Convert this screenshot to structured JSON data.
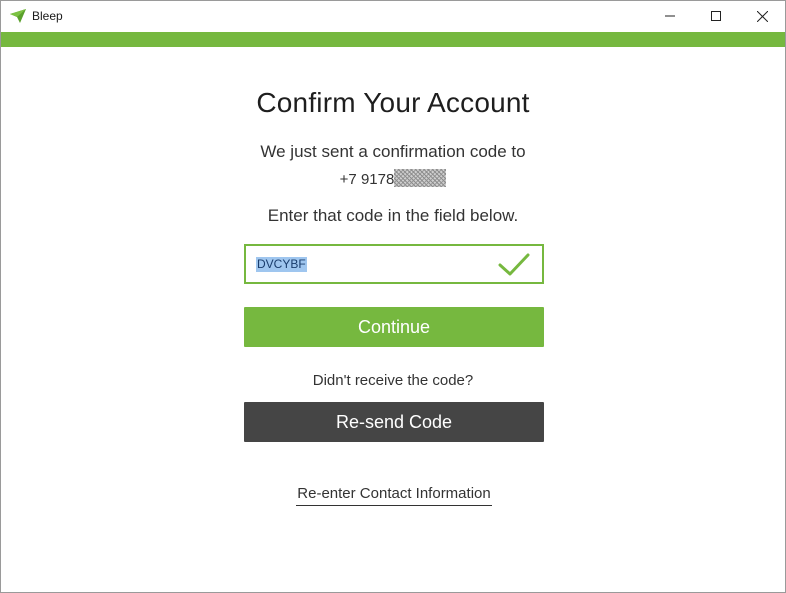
{
  "window": {
    "title": "Bleep",
    "controls": [
      "minimize-icon",
      "maximize-icon",
      "close-icon"
    ],
    "accent_color": "#76b83f"
  },
  "confirm": {
    "heading": "Confirm Your Account",
    "sent_text": "We just sent a confirmation code to",
    "phone_visible": "+7 9178",
    "instruction": "Enter that code in the field below.",
    "code_value": "DVCYBF",
    "continue_label": "Continue",
    "didnt_receive": "Didn't receive the code?",
    "resend_label": "Re-send Code",
    "reenter_label": "Re-enter Contact Information"
  },
  "colors": {
    "continue_button": "#76b83f",
    "resend_button": "#454545"
  }
}
